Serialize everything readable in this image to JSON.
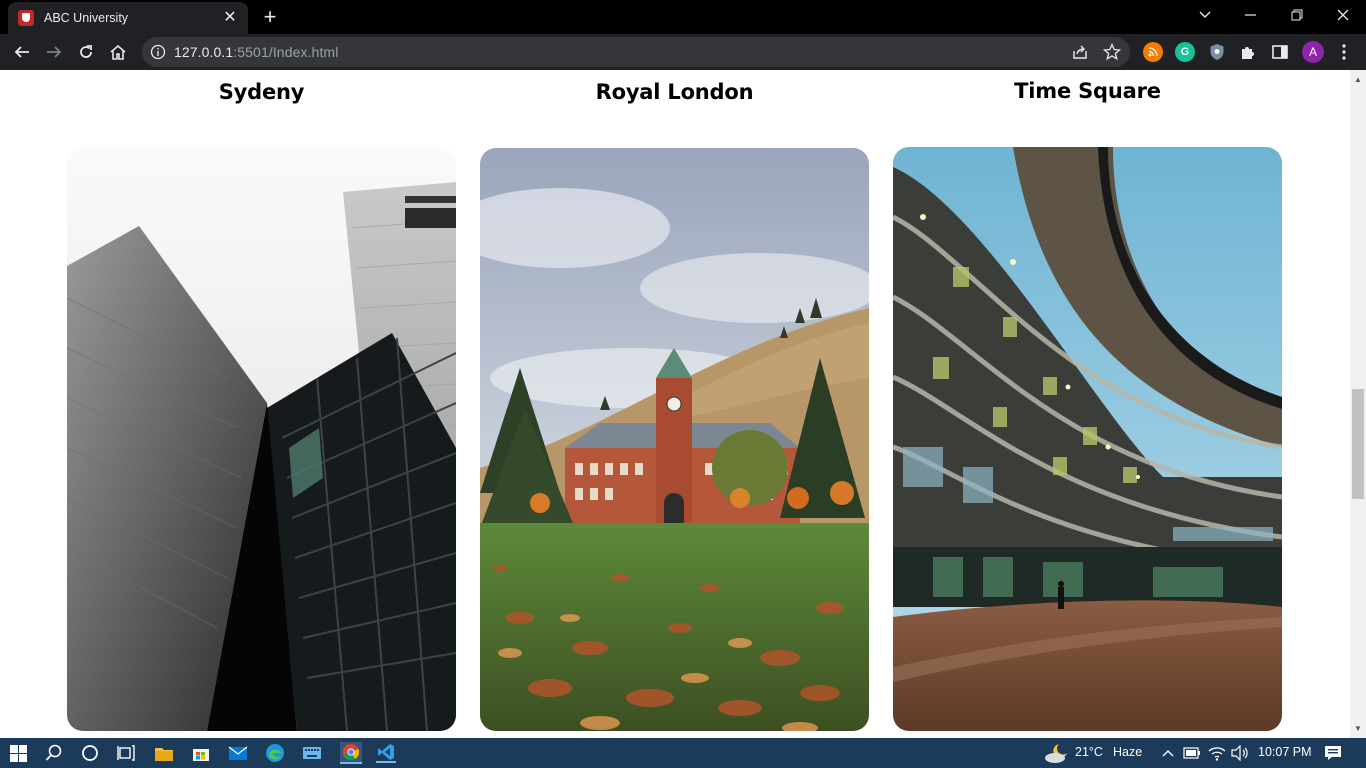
{
  "browser": {
    "tab_title": "ABC University",
    "tab_close": "✕",
    "new_tab": "+",
    "url_host": "127.0.0.1",
    "url_rest": ":5501/Index.html",
    "profile_initial": "A"
  },
  "cards": [
    {
      "title": "Sydeny",
      "image": "modern-building-photo"
    },
    {
      "title": "Royal London",
      "image": "clock-tower-campus-photo"
    },
    {
      "title": "Time Square",
      "image": "curved-glass-building-photo"
    }
  ],
  "taskbar": {
    "weather_temp": "21°C",
    "weather_desc": "Haze",
    "clock": "10:07 PM"
  },
  "colors": {
    "tabbar": "#000000",
    "toolbar": "#202124",
    "taskbar": "#1c3a59"
  }
}
